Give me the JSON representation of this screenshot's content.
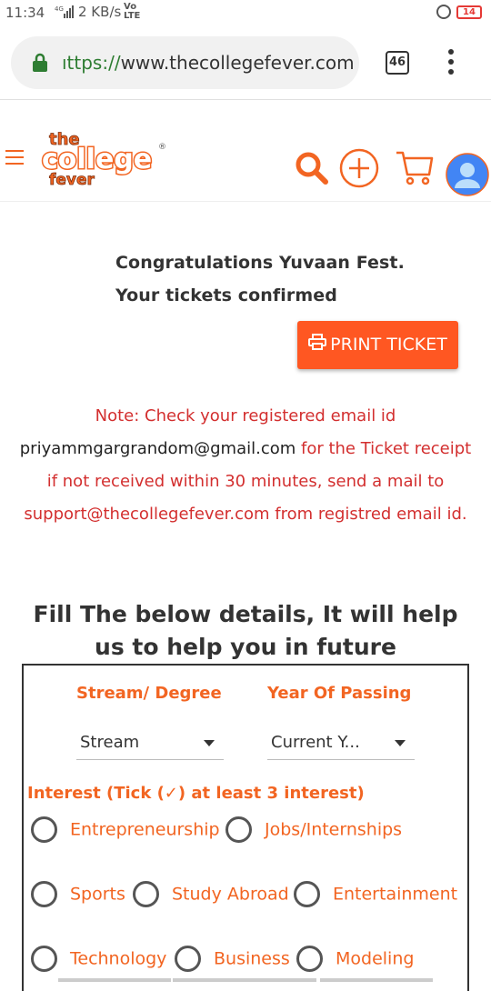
{
  "status": {
    "time": "11:34",
    "network": "4G",
    "speed": "2 KB/s",
    "lte": "Vo LTE",
    "battery": "14"
  },
  "browser": {
    "url_proto": "ıttps://",
    "url_host": "www.thecollegefever.com",
    "tab_count": "46"
  },
  "header": {
    "logo_the": "the",
    "logo_college": "college",
    "logo_fever": "fever",
    "registered": "®"
  },
  "confirmation": {
    "line1": "Congratulations Yuvaan Fest.",
    "line2": "Your tickets confirmed",
    "print_label": "PRINT TICKET"
  },
  "note": {
    "part1": "Note: Check your registered email id",
    "email": "priyammgargrandom@gmail.com",
    "part2": " for the Ticket receipt if not received within 30 minutes, send a mail to support@thecollegefever.com from registred email id."
  },
  "form": {
    "heading": "Fill The below details, It will help us to help you in future",
    "stream_label": "Stream/ Degree",
    "year_label": "Year Of Passing",
    "stream_value": "Stream",
    "year_value": "Current Y...",
    "interest_label": "Interest (Tick (✓) at least 3 interest)",
    "interests": [
      "Entrepreneurship",
      "Jobs/Internships",
      "Sports",
      "Study Abroad",
      "Entertainment",
      "Technology",
      "Business",
      "Modeling"
    ]
  },
  "colors": {
    "brand": "#f26522",
    "button": "#ff5722",
    "note": "#d32f2f"
  }
}
